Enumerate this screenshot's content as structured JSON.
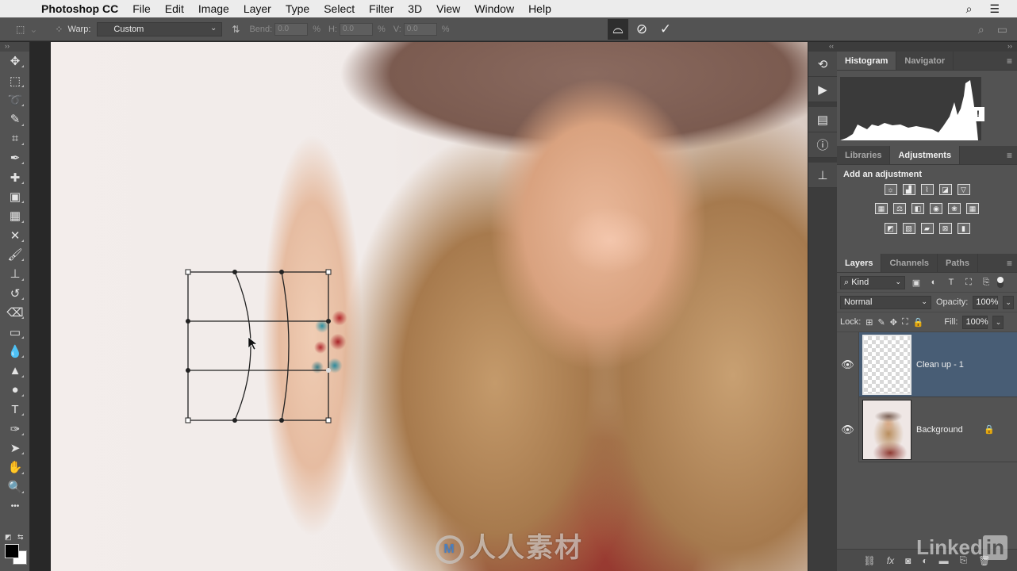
{
  "menubar": {
    "apple_icon": "apple-logo-icon",
    "app_name": "Photoshop CC",
    "items": [
      "File",
      "Edit",
      "Image",
      "Layer",
      "Type",
      "Select",
      "Filter",
      "3D",
      "View",
      "Window",
      "Help"
    ],
    "right_icons": [
      "search-icon",
      "list-icon"
    ]
  },
  "options_bar": {
    "tool_icon": "transform-icon",
    "warp_label": "Warp:",
    "warp_value": "Custom",
    "bend_label": "Bend:",
    "bend_value": "0.0",
    "h_label": "H:",
    "h_value": "0.0",
    "v_label": "V:",
    "v_value": "0.0",
    "percent": "%",
    "buttons": [
      "switch-transform-warp",
      "cancel",
      "commit"
    ]
  },
  "tools": [
    {
      "name": "move-tool",
      "glyph": "✥"
    },
    {
      "name": "rectangular-marquee-tool",
      "glyph": "⬚"
    },
    {
      "name": "lasso-tool",
      "glyph": "➰"
    },
    {
      "name": "quick-selection-tool",
      "glyph": "✎"
    },
    {
      "name": "crop-tool",
      "glyph": "⌗"
    },
    {
      "name": "eyedropper-tool",
      "glyph": "✒"
    },
    {
      "name": "spot-healing-brush-tool",
      "glyph": "✚"
    },
    {
      "name": "healing-brush-tool",
      "glyph": "▣"
    },
    {
      "name": "patch-tool",
      "glyph": "▦"
    },
    {
      "name": "content-aware-move-tool",
      "glyph": "✕"
    },
    {
      "name": "brush-tool",
      "glyph": "🖌"
    },
    {
      "name": "clone-stamp-tool",
      "glyph": "⊥"
    },
    {
      "name": "history-brush-tool",
      "glyph": "↺"
    },
    {
      "name": "eraser-tool",
      "glyph": "⌫"
    },
    {
      "name": "gradient-tool",
      "glyph": "▭"
    },
    {
      "name": "blur-tool",
      "glyph": "💧"
    },
    {
      "name": "dodge-tool",
      "glyph": "▲"
    },
    {
      "name": "sponge-tool",
      "glyph": "●"
    },
    {
      "name": "type-tool",
      "glyph": "T"
    },
    {
      "name": "pen-tool",
      "glyph": "✑"
    },
    {
      "name": "path-selection-tool",
      "glyph": "➤"
    },
    {
      "name": "hand-tool",
      "glyph": "✋"
    },
    {
      "name": "zoom-tool",
      "glyph": "🔍"
    },
    {
      "name": "edit-toolbar",
      "glyph": "•••"
    }
  ],
  "colors": {
    "foreground": "#000000",
    "background": "#ffffff"
  },
  "icon_strip": [
    "history-icon",
    "actions-play-icon",
    "properties-icon",
    "info-icon",
    "clone-source-icon"
  ],
  "panels": {
    "top_tabs": [
      "Histogram",
      "Navigator"
    ],
    "histogram_warning": "!",
    "mid_tabs": [
      "Libraries",
      "Adjustments"
    ],
    "adjustments_title": "Add an adjustment",
    "adjustment_rows": [
      [
        "brightness-contrast",
        "levels",
        "curves",
        "exposure",
        "vibrance"
      ],
      [
        "hue-saturation",
        "color-balance",
        "black-white",
        "photo-filter",
        "channel-mixer",
        "color-lookup"
      ],
      [
        "invert",
        "posterize",
        "threshold",
        "selective-color",
        "gradient-map"
      ]
    ],
    "layer_tabs": [
      "Layers",
      "Channels",
      "Paths"
    ],
    "kind_filter": "Kind",
    "blend_mode": "Normal",
    "opacity_label": "Opacity:",
    "opacity_value": "100%",
    "lock_label": "Lock:",
    "fill_label": "Fill:",
    "fill_value": "100%",
    "layers": [
      {
        "name": "Clean up - 1",
        "visible": true,
        "selected": true,
        "locked": false
      },
      {
        "name": "Background",
        "visible": true,
        "selected": false,
        "locked": true
      }
    ],
    "footer_icons": [
      "link-layers",
      "fx",
      "add-mask",
      "new-adjustment",
      "new-group",
      "new-layer",
      "delete-layer"
    ]
  },
  "watermarks": {
    "brand_text": "人人素材",
    "linkedin_text": "Linked",
    "linkedin_in": "in"
  },
  "colors_ui": {
    "selected_layer": "#485d75",
    "panel_bg": "#535353",
    "menubar_bg": "#ececec"
  }
}
